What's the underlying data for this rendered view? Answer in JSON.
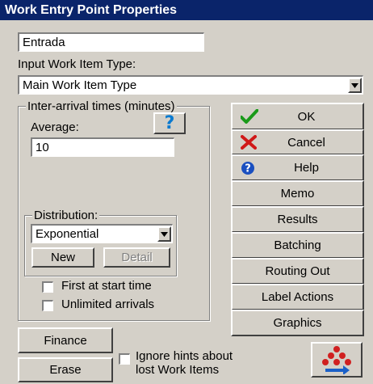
{
  "window": {
    "title": "Work Entry Point Properties"
  },
  "name_field": {
    "value": "Entrada"
  },
  "input_type": {
    "label": "Input Work Item Type:",
    "selected": "Main Work Item Type"
  },
  "interarrival": {
    "group_title": "Inter-arrival times (minutes)",
    "average_label": "Average:",
    "average_value": "10",
    "help_glyph": "?",
    "distribution": {
      "group_title": "Distribution:",
      "selected": "Exponential",
      "new_label": "New",
      "detail_label": "Detail"
    },
    "first_at_start_label": "First at start time",
    "unlimited_label": "Unlimited arrivals"
  },
  "buttons": {
    "ok": "OK",
    "cancel": "Cancel",
    "help": "Help",
    "memo": "Memo",
    "results": "Results",
    "batching": "Batching",
    "routing_out": "Routing Out",
    "label_actions": "Label Actions",
    "graphics": "Graphics",
    "finance": "Finance",
    "erase": "Erase"
  },
  "ignore_hints": {
    "line1": "Ignore hints about",
    "line2": "lost Work Items"
  },
  "colors": {
    "titlebar": "#0a246a",
    "face": "#d4d0c8",
    "ok_check": "#1a9a1a",
    "cancel_x": "#d01818",
    "help_blue": "#1a4fc0"
  },
  "icons": {
    "ok": "checkmark-icon",
    "cancel": "x-icon",
    "help": "question-circle-icon",
    "help_button": "question-mark-icon",
    "dropdown": "dropdown-arrow-icon",
    "workitems": "work-items-icon"
  }
}
